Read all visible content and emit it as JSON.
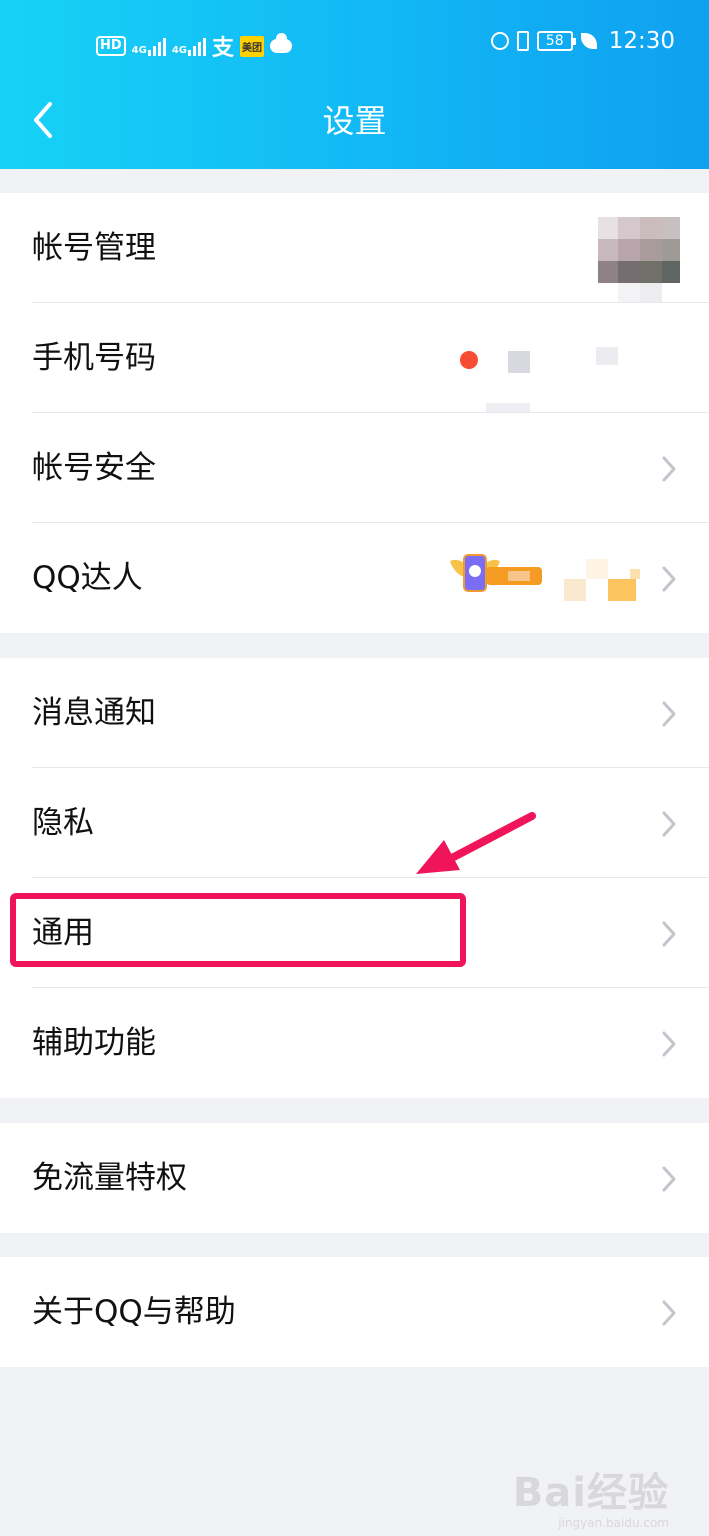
{
  "status_bar": {
    "hd_label": "HD",
    "network_1": "4G",
    "network_2": "4G",
    "pay_icon": "支",
    "meituan_label": "美团",
    "battery_level": "58",
    "time": "12:30"
  },
  "header": {
    "title": "设置",
    "back_icon": "chevron-left-icon"
  },
  "groups": [
    {
      "items": [
        {
          "label": "帐号管理"
        },
        {
          "label": "手机号码"
        },
        {
          "label": "帐号安全"
        },
        {
          "label": "QQ达人"
        }
      ]
    },
    {
      "items": [
        {
          "label": "消息通知"
        },
        {
          "label": "隐私"
        },
        {
          "label": "通用"
        },
        {
          "label": "辅助功能"
        }
      ]
    },
    {
      "items": [
        {
          "label": "免流量特权"
        }
      ]
    },
    {
      "items": [
        {
          "label": "关于QQ与帮助"
        }
      ]
    }
  ],
  "annotation": {
    "highlighted_item": "通用",
    "color": "#f0145a"
  },
  "watermark": {
    "text": "Bai经验",
    "sub": "jingyan.baidu.com"
  },
  "colors": {
    "header_start": "#17d2f6",
    "header_end": "#0fa0f0",
    "background": "#f1f2f6",
    "chevron": "#c4c4cc"
  }
}
